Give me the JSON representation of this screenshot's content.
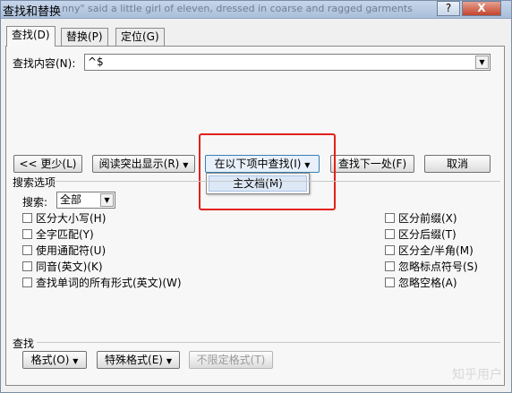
{
  "window": {
    "title": "查找和替换",
    "bg_text": "nny\" said a little girl of eleven, dressed in coarse and ragged garments",
    "help_label": "?",
    "close_label": "X"
  },
  "tabs": [
    {
      "label": "查找(D)"
    },
    {
      "label": "替换(P)"
    },
    {
      "label": "定位(G)"
    }
  ],
  "find": {
    "label": "查找内容(N):",
    "value": "^$"
  },
  "buttons": {
    "less": "<< 更少(L)",
    "reading_highlight": "阅读突出显示(R)",
    "find_in": "在以下项中查找(I)",
    "find_next": "查找下一处(F)",
    "cancel": "取消"
  },
  "find_in_menu": {
    "items": [
      "主文档(M)"
    ]
  },
  "search_options": {
    "group_label": "搜索选项",
    "search_label": "搜索:",
    "search_value": "全部",
    "left_checkboxes": [
      "区分大小写(H)",
      "全字匹配(Y)",
      "使用通配符(U)",
      "同音(英文)(K)",
      "查找单词的所有形式(英文)(W)"
    ],
    "right_checkboxes": [
      "区分前缀(X)",
      "区分后缀(T)",
      "区分全/半角(M)",
      "忽略标点符号(S)",
      "忽略空格(A)"
    ]
  },
  "find_section": {
    "label": "查找",
    "format": "格式(O)",
    "special": "特殊格式(E)",
    "no_format": "不限定格式(T)"
  },
  "watermark": "知乎用户"
}
